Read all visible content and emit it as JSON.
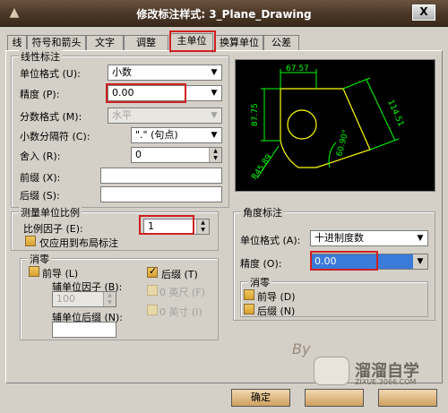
{
  "window": {
    "title": "修改标注样式: 3_Plane_Drawing",
    "close_symbol": "X"
  },
  "tabs": [
    {
      "label": "线"
    },
    {
      "label": "符号和箭头"
    },
    {
      "label": "文字"
    },
    {
      "label": "调整"
    },
    {
      "label": "主单位",
      "active": true
    },
    {
      "label": "换算单位"
    },
    {
      "label": "公差"
    }
  ],
  "linear": {
    "title": "线性标注",
    "unit_format_label": "单位格式 (U):",
    "unit_format_value": "小数",
    "precision_label": "精度 (P):",
    "precision_value": "0.00",
    "fraction_label": "分数格式 (M):",
    "fraction_value": "水平",
    "decimal_sep_label": "小数分隔符 (C):",
    "decimal_sep_value": "\".\" (句点)",
    "round_label": "舍入 (R):",
    "round_value": "0",
    "prefix_label": "前缀 (X):",
    "prefix_value": "",
    "suffix_label": "后缀 (S):",
    "suffix_value": ""
  },
  "scale": {
    "title": "测量单位比例",
    "factor_label": "比例因子 (E):",
    "factor_value": "1",
    "layout_only_label": "仅应用到布局标注"
  },
  "zero_linear": {
    "title": "消零",
    "leading_label": "前导 (L)",
    "trailing_label": "后缀 (T)",
    "sub_factor_label": "辅单位因子 (B):",
    "sub_factor_value": "100",
    "feet_label": "0 英尺 (F)",
    "inch_label": "0 英寸 (I)",
    "sub_suffix_label": "辅单位后缀 (N):",
    "sub_suffix_value": ""
  },
  "preview": {
    "dim_top": "67.57",
    "dim_left": "87.75",
    "dim_right": "114.51",
    "dim_angle": "60.90°",
    "dim_radius": "R45.89"
  },
  "angular": {
    "title": "角度标注",
    "unit_format_label": "单位格式 (A):",
    "unit_format_value": "十进制度数",
    "precision_label": "精度 (O):",
    "precision_value": "0.00"
  },
  "zero_angular": {
    "title": "消零",
    "leading_label": "前导 (D)",
    "trailing_label": "后缀 (N)"
  },
  "watermark": {
    "brand": "溜溜自学",
    "url": "ZIXUE.3066.COM",
    "signature": "By"
  },
  "footer": {
    "ok_label": "确定"
  },
  "colors": {
    "highlight": "#d02020",
    "preview_dim": "#00ff00",
    "preview_geom": "#ffff00"
  }
}
